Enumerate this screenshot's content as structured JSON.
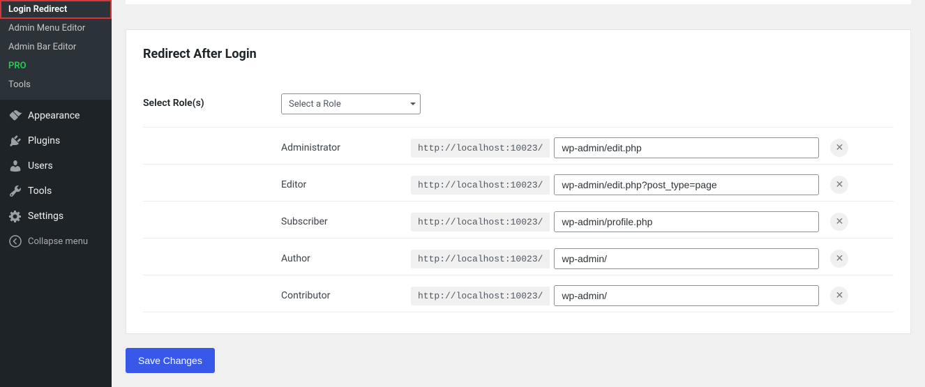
{
  "sidebar": {
    "submenu": [
      {
        "label": "Login Redirect",
        "active": true,
        "highlighted": true
      },
      {
        "label": "Admin Menu Editor"
      },
      {
        "label": "Admin Bar Editor"
      },
      {
        "label": "PRO",
        "pro": true
      },
      {
        "label": "Tools"
      }
    ],
    "menu": [
      {
        "label": "Appearance",
        "icon": "appearance-icon"
      },
      {
        "label": "Plugins",
        "icon": "plugins-icon"
      },
      {
        "label": "Users",
        "icon": "users-icon"
      },
      {
        "label": "Tools",
        "icon": "tools-icon"
      },
      {
        "label": "Settings",
        "icon": "settings-icon"
      }
    ],
    "collapse_label": "Collapse menu"
  },
  "panel": {
    "title": "Redirect After Login",
    "select_roles_label": "Select Role(s)",
    "select_placeholder": "Select a Role",
    "url_prefix": "http://localhost:10023/",
    "roles": [
      {
        "name": "Administrator",
        "value": "wp-admin/edit.php"
      },
      {
        "name": "Editor",
        "value": "wp-admin/edit.php?post_type=page"
      },
      {
        "name": "Subscriber",
        "value": "wp-admin/profile.php"
      },
      {
        "name": "Author",
        "value": "wp-admin/"
      },
      {
        "name": "Contributor",
        "value": "wp-admin/"
      }
    ],
    "save_label": "Save Changes"
  }
}
